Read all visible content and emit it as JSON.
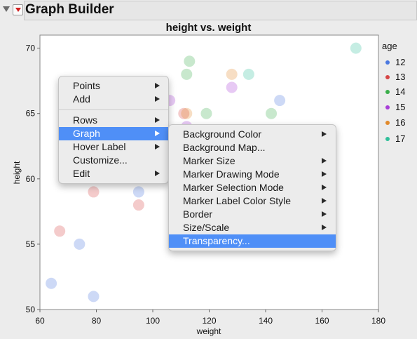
{
  "window": {
    "title": "Graph Builder"
  },
  "chart_data": {
    "type": "scatter",
    "title": "height vs. weight",
    "xlabel": "weight",
    "ylabel": "height",
    "xlim": [
      60,
      180
    ],
    "ylim": [
      50,
      71
    ],
    "xticks": [
      60,
      80,
      100,
      120,
      140,
      160,
      180
    ],
    "yticks": [
      50,
      55,
      60,
      65,
      70
    ],
    "grid": false,
    "legend_placement": "right",
    "legend_title": "age",
    "series": [
      {
        "name": "12",
        "color": "#4a78e0",
        "points": [
          [
            64,
            52
          ],
          [
            79,
            51
          ],
          [
            74,
            55
          ],
          [
            95,
            59
          ],
          [
            145,
            66
          ]
        ]
      },
      {
        "name": "13",
        "color": "#d64545",
        "points": [
          [
            67,
            56
          ],
          [
            79,
            59
          ],
          [
            95,
            58
          ],
          [
            111,
            65
          ]
        ]
      },
      {
        "name": "14",
        "color": "#3aae4a",
        "points": [
          [
            112,
            68
          ],
          [
            113,
            69
          ],
          [
            119,
            65
          ],
          [
            142,
            65
          ]
        ]
      },
      {
        "name": "15",
        "color": "#a83ed8",
        "points": [
          [
            106,
            66
          ],
          [
            112,
            64
          ],
          [
            128,
            67
          ]
        ]
      },
      {
        "name": "16",
        "color": "#e18a2c",
        "points": [
          [
            112,
            65
          ],
          [
            128,
            68
          ]
        ]
      },
      {
        "name": "17",
        "color": "#2fbf9a",
        "points": [
          [
            134,
            68
          ],
          [
            172,
            70
          ]
        ]
      }
    ]
  },
  "context_menu": {
    "items": [
      {
        "label": "Points",
        "submenu": true
      },
      {
        "label": "Add",
        "submenu": true
      },
      {
        "separator": true
      },
      {
        "label": "Rows",
        "submenu": true
      },
      {
        "label": "Graph",
        "submenu": true,
        "active": true
      },
      {
        "label": "Hover Label",
        "submenu": true
      },
      {
        "label": "Customize...",
        "submenu": false
      },
      {
        "label": "Edit",
        "submenu": true
      }
    ]
  },
  "graph_submenu": {
    "items": [
      {
        "label": "Background Color",
        "submenu": true
      },
      {
        "label": "Background Map...",
        "submenu": false
      },
      {
        "label": "Marker Size",
        "submenu": true
      },
      {
        "label": "Marker Drawing Mode",
        "submenu": true
      },
      {
        "label": "Marker Selection Mode",
        "submenu": true
      },
      {
        "label": "Marker Label Color Style",
        "submenu": true
      },
      {
        "label": "Border",
        "submenu": true
      },
      {
        "label": "Size/Scale",
        "submenu": true
      },
      {
        "label": "Transparency...",
        "submenu": false,
        "active": true
      }
    ]
  }
}
